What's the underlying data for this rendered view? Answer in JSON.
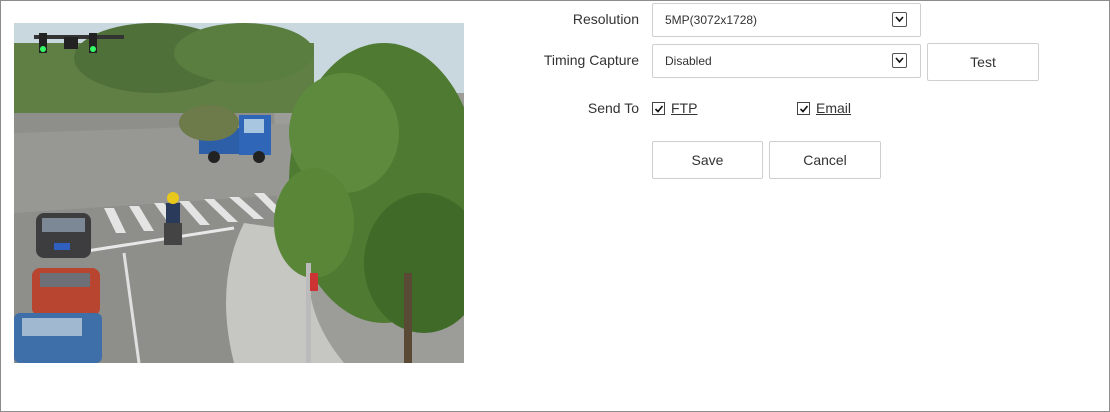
{
  "preview": {
    "description_icon": "camera-snapshot-image"
  },
  "form": {
    "resolution": {
      "label": "Resolution",
      "value": "5MP(3072x1728)"
    },
    "timing_capture": {
      "label": "Timing Capture",
      "value": "Disabled",
      "test_label": "Test"
    },
    "send_to": {
      "label": "Send To",
      "ftp": {
        "label": "FTP",
        "checked": true
      },
      "email": {
        "label": "Email",
        "checked": true
      }
    },
    "buttons": {
      "save": "Save",
      "cancel": "Cancel"
    }
  }
}
